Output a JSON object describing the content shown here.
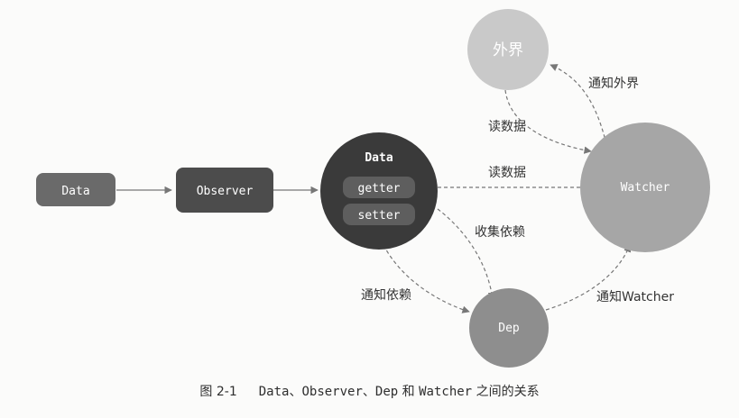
{
  "nodes": {
    "data_box": {
      "label": "Data"
    },
    "observer_box": {
      "label": "Observer"
    },
    "data_circle": {
      "title": "Data",
      "getter": "getter",
      "setter": "setter"
    },
    "outside": {
      "label": "外界"
    },
    "watcher": {
      "label": "Watcher"
    },
    "dep": {
      "label": "Dep"
    }
  },
  "edges": {
    "notify_outside": "通知外界",
    "read_data_top": "读数据",
    "read_data_mid": "读数据",
    "collect_deps": "收集依赖",
    "notify_deps": "通知依赖",
    "notify_watcher": "通知Watcher"
  },
  "caption": {
    "figure_no": "图 2-1",
    "t1": "Data",
    "s1": "、",
    "t2": "Observer",
    "s2": "、",
    "t3": "Dep",
    "s3": " 和 ",
    "t4": "Watcher",
    "s4": " 之间的关系"
  },
  "colors": {
    "data_box": "#6a6a6a",
    "observer_box": "#4c4c4c",
    "data_circle": "#3a3a3a",
    "pill": "#5e5e5e",
    "outside": "#c9c9c9",
    "watcher": "#a6a6a6",
    "dep": "#8e8e8e",
    "arrow": "#777777"
  }
}
